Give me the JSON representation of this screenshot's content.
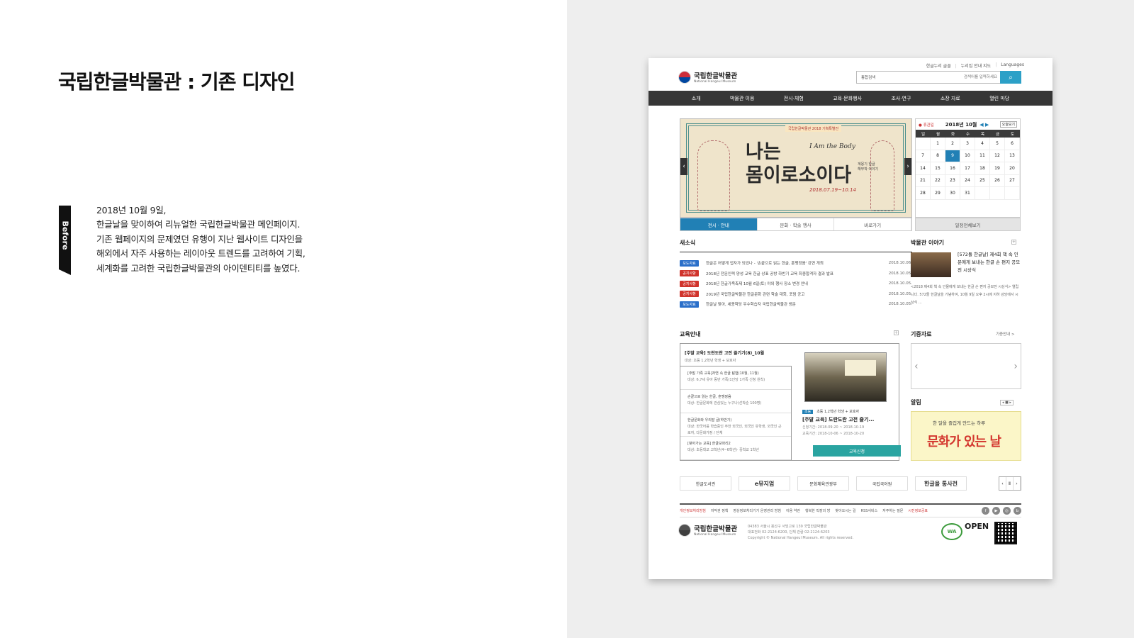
{
  "left": {
    "title": "국립한글박물관 : 기존 디자인",
    "tag": "Before",
    "description": [
      "2018년 10월 9일,",
      "한글날을 맞이하여  리뉴얼한 국립한글박물관 메인페이지.",
      "기존 웹페이지의 문제였던 유행이 지난 웹사이트 디자인을",
      "해외에서 자주 사용하는 레이아웃 트렌드를 고려하여  기획,",
      "세계화를 고려한 국립한글박물관의 아이덴티티를 높였다."
    ]
  },
  "site": {
    "util_links": [
      "한글누리 글꼴",
      "누리집 안내 지도",
      "Languages"
    ],
    "logo_ko": "국립한글박물관",
    "logo_en": "National Hangeul Museum",
    "search": {
      "select": "통합검색",
      "placeholder": "검색어를 입력하세요",
      "button_icon": "search-icon"
    },
    "gnb": [
      "소개",
      "박물관 이용",
      "전시·체험",
      "교육·문화행사",
      "조사·연구",
      "소장 자료",
      "열린 마당"
    ],
    "banner": {
      "subtitle": "국립한글박물관 2018 기획특별전",
      "title_line1": "나는",
      "title_line2": "몸이로소이다",
      "english": "I Am the Body",
      "side_text": "계몽기 한글 해부학 이야기",
      "dates": "2018.07.19~10.14"
    },
    "tabs": [
      "전시 · 안내",
      "문화 · 학술 행사",
      "바로가기"
    ],
    "calendar": {
      "holiday_label": "휴관일",
      "month": "2018년 10월",
      "today_btn": "오늘보기",
      "weekdays": [
        "일",
        "월",
        "화",
        "수",
        "목",
        "금",
        "토"
      ],
      "days": [
        "",
        "1",
        "2",
        "3",
        "4",
        "5",
        "6",
        "7",
        "8",
        "9",
        "10",
        "11",
        "12",
        "13",
        "14",
        "15",
        "16",
        "17",
        "18",
        "19",
        "20",
        "21",
        "22",
        "23",
        "24",
        "25",
        "26",
        "27",
        "28",
        "29",
        "30",
        "31",
        "",
        "",
        ""
      ],
      "selected": "9",
      "all_btn": "일정전체보기"
    },
    "news": {
      "title": "새소식",
      "rows": [
        {
          "tag": "보도자료",
          "color": "#2a6fc9",
          "title": "한글은 어떻게 업자가 되었나 - '손끝으로 읽는 한글, 훈맹정음' 강연 개최",
          "date": "2018.10.06."
        },
        {
          "tag": "공지사항",
          "color": "#d0342c",
          "title": "2018년 전문인력 양성 교육 한글 상표 공방 하반기 교육 최종합격자 결과 발표",
          "date": "2018.10.05."
        },
        {
          "tag": "공지사항",
          "color": "#d0342c",
          "title": "2018년 한글가족축제 10월 6일(토) 야외 행사 장소 변경 안내",
          "date": "2018.10.05."
        },
        {
          "tag": "공지사항",
          "color": "#d0342c",
          "title": "2019년 국립한글박물관 한글문화 관련 학술 대회, 포럼 공고",
          "date": "2018.10.05."
        },
        {
          "tag": "보도자료",
          "color": "#2a6fc9",
          "title": "한글날 맞아, 세종학당 우수학습자 국립한글박물관 방문",
          "date": "2018.10.05."
        }
      ]
    },
    "story": {
      "title": "박물관 이야기",
      "headline": "[572돌 한글날] 제4회 책 속 인문에게 보내는 한글 손 편지 공모전 시상식",
      "desc": "<2018 제4회 책 속 인물에게 보내는 한글 손 편지 공모전 시상식> 열립니다. 572돌 한글날을 기념하여, 10월 9일 오후 2시에 지하 강당에서 시상식 ..."
    },
    "edu": {
      "title": "교육안내",
      "feature_title": "[주말 교육] 도란도란 고전 즐기기(8)_10월",
      "feature_sub": "대상: 초등 1,2학년 학생 + 보호자",
      "items": [
        {
          "t": "[주말 가족 교육]자연 속 한글 탐험(10월, 11월)",
          "s": "대상: 6,7세 유아 동반 가족(1인당 1가족 신청 원칙)"
        },
        {
          "t": "손끝으로 읽는 한글, 훈맹정음",
          "s": "대상: 한글문화에 관심있는 누구나(선착순 100명)"
        },
        {
          "t": "한글문화와 우리말 글(하반기)",
          "s": "대상: 한국어를 학습중인 주한 외국인, 외국인 유학생, 외국인 근로자, 다문화가정 / 단체"
        },
        {
          "t": "[찾아가는 교육] 한글보따리2",
          "s": "대상: 초등학교 고학년(4~6학년)· 중학교 1학년"
        }
      ],
      "badge": "초등",
      "info_target": "초등 1,2학년 학생 + 보호자",
      "info_title": "[주말 교육] 도란도란 고전 즐기...",
      "apply_period": "신청기간: 2018-09-20 ~ 2018-10-19",
      "edu_period": "교육기간: 2018-10-06 ~ 2018-10-20",
      "apply_btn": "교육신청"
    },
    "donate": {
      "title": "기증자료",
      "more": "기증안내 >"
    },
    "notice": {
      "title": "알림",
      "line1": "한 달을 즐겁게 만드는 하루",
      "line2": "문화가 있는 날"
    },
    "family": [
      "한글도서관",
      "e뮤지엄",
      "문화체육관광부",
      "국립국어원",
      "한글을 통사전"
    ],
    "footer_links": [
      "개인정보처리방침",
      "저작권 정책",
      "영상정보처리기기 운영관리 방침",
      "이용 약관",
      "행복한 직장의 방",
      "찾아오시는 길",
      "RSS서비스",
      "자주하는 질문",
      "시진정보공표"
    ],
    "footer_addr": [
      "04383 서울시 용산구 서빙고로 139 국립한글박물관",
      "대표전화 02-2124-6200, 단체 관람 02-2124-6203",
      "Copyright © National Hangeul Museum. All rights reserved."
    ],
    "wa_text": "WA",
    "open_text": "OPEN"
  }
}
